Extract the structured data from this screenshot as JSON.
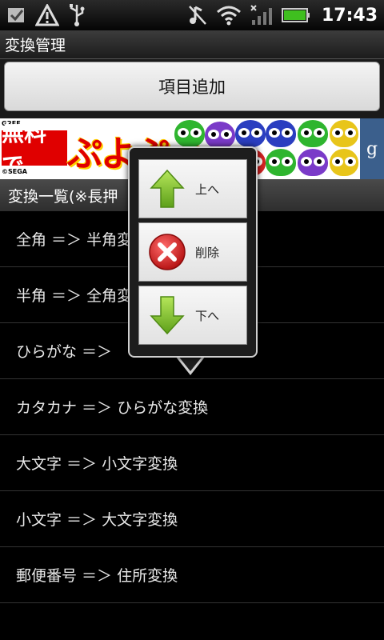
{
  "status_bar": {
    "time": "17:43",
    "icons": [
      "checkbox-icon",
      "warning-icon",
      "usb-icon",
      "mute-icon",
      "wifi-icon",
      "signal-icon",
      "battery-icon"
    ]
  },
  "title_bar": {
    "title": "変換管理"
  },
  "toolbar": {
    "add_label": "項目追加"
  },
  "ad": {
    "brand": "GREE",
    "free_text": "無料で",
    "game_text": "ぷよぷよ",
    "copyright": "©SEGA",
    "side_letter": "g"
  },
  "list": {
    "header": "変換一覧(※長押",
    "items": [
      "全角 ＝＞ 半角変",
      "半角 ＝＞ 全角変",
      "ひらがな ＝＞",
      "カタカナ ＝＞ ひらがな変換",
      "大文字 ＝＞ 小文字変換",
      "小文字 ＝＞ 大文字変換",
      "郵便番号 ＝＞ 住所変換"
    ]
  },
  "popup": {
    "items": [
      {
        "label": "上へ",
        "icon": "up-arrow-icon"
      },
      {
        "label": "削除",
        "icon": "delete-icon"
      },
      {
        "label": "下へ",
        "icon": "down-arrow-icon"
      }
    ]
  },
  "colors": {
    "accent_green": "#7fc31c",
    "delete_red": "#d41c1c",
    "battery_green": "#3fbf1f"
  }
}
